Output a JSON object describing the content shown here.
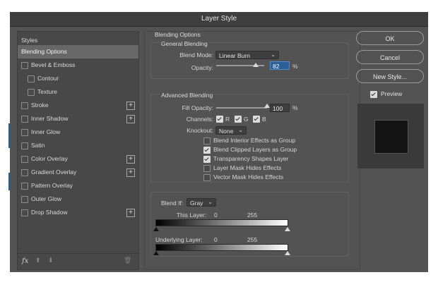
{
  "window": {
    "title": "Layer Style"
  },
  "styles_panel": {
    "header": "Styles",
    "items": [
      {
        "label": "Blending Options",
        "selected": true,
        "checkbox": false,
        "indent": 0,
        "plus": false
      },
      {
        "label": "Bevel & Emboss",
        "selected": false,
        "checkbox": true,
        "indent": 0,
        "plus": false
      },
      {
        "label": "Contour",
        "selected": false,
        "checkbox": true,
        "indent": 1,
        "plus": false
      },
      {
        "label": "Texture",
        "selected": false,
        "checkbox": true,
        "indent": 1,
        "plus": false
      },
      {
        "label": "Stroke",
        "selected": false,
        "checkbox": true,
        "indent": 0,
        "plus": true
      },
      {
        "label": "Inner Shadow",
        "selected": false,
        "checkbox": true,
        "indent": 0,
        "plus": true
      },
      {
        "label": "Inner Glow",
        "selected": false,
        "checkbox": true,
        "indent": 0,
        "plus": false
      },
      {
        "label": "Satin",
        "selected": false,
        "checkbox": true,
        "indent": 0,
        "plus": false
      },
      {
        "label": "Color Overlay",
        "selected": false,
        "checkbox": true,
        "indent": 0,
        "plus": true
      },
      {
        "label": "Gradient Overlay",
        "selected": false,
        "checkbox": true,
        "indent": 0,
        "plus": true
      },
      {
        "label": "Pattern Overlay",
        "selected": false,
        "checkbox": true,
        "indent": 0,
        "plus": false
      },
      {
        "label": "Outer Glow",
        "selected": false,
        "checkbox": true,
        "indent": 0,
        "plus": false
      },
      {
        "label": "Drop Shadow",
        "selected": false,
        "checkbox": true,
        "indent": 0,
        "plus": true
      }
    ],
    "footer": {
      "fx_label": "fx"
    }
  },
  "blending": {
    "section_title": "Blending Options",
    "general_title": "General Blending",
    "blend_mode_label": "Blend Mode:",
    "blend_mode_value": "Linear Burn",
    "opacity_label": "Opacity:",
    "opacity_value": "82",
    "opacity_unit": "%",
    "opacity_level": 0.82,
    "advanced_title": "Advanced Blending",
    "fill_opacity_label": "Fill Opacity:",
    "fill_opacity_value": "100",
    "fill_opacity_unit": "%",
    "fill_opacity_level": 1.0,
    "channels_label": "Channels:",
    "channels": [
      {
        "label": "R",
        "checked": true
      },
      {
        "label": "G",
        "checked": true
      },
      {
        "label": "B",
        "checked": true
      }
    ],
    "knockout_label": "Knockout:",
    "knockout_value": "None",
    "options": [
      {
        "label": "Blend Interior Effects as Group",
        "checked": false
      },
      {
        "label": "Blend Clipped Layers as Group",
        "checked": true
      },
      {
        "label": "Transparency Shapes Layer",
        "checked": true
      },
      {
        "label": "Layer Mask Hides Effects",
        "checked": false
      },
      {
        "label": "Vector Mask Hides Effects",
        "checked": false
      }
    ],
    "blend_if_label": "Blend If:",
    "blend_if_value": "Gray",
    "this_layer_label": "This Layer:",
    "this_layer_min": "0",
    "this_layer_max": "255",
    "underlying_label": "Underlying Layer:",
    "underlying_min": "0",
    "underlying_max": "255"
  },
  "buttons": {
    "ok": "OK",
    "cancel": "Cancel",
    "new_style": "New Style...",
    "preview_label": "Preview",
    "preview_checked": true
  },
  "colors": {
    "panel": "#535353",
    "accent_focus": "#2d5f97"
  }
}
